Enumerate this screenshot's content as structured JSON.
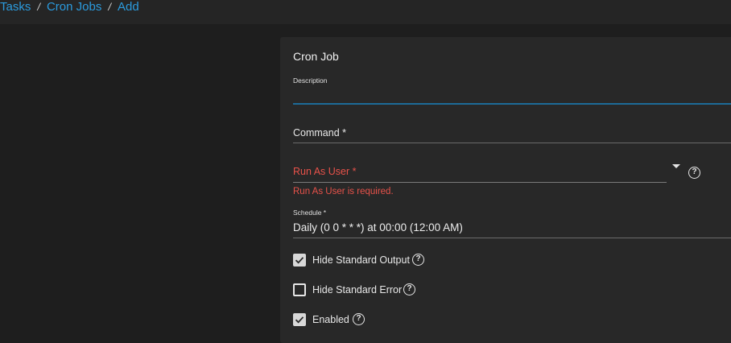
{
  "breadcrumb": {
    "items": [
      "Tasks",
      "Cron Jobs",
      "Add"
    ],
    "separator": "/"
  },
  "form": {
    "title": "Cron Job",
    "description": {
      "label": "Description",
      "value": ""
    },
    "command": {
      "label": "Command *",
      "value": ""
    },
    "run_as_user": {
      "label": "Run As User *",
      "error": "Run As User is required.",
      "value": ""
    },
    "schedule": {
      "label": "Schedule *",
      "value": "Daily (0 0 * * *) at 00:00 (12:00 AM)"
    },
    "hide_stdout": {
      "label": "Hide Standard Output",
      "checked": true
    },
    "hide_stderr": {
      "label": "Hide Standard Error",
      "checked": false
    },
    "enabled": {
      "label": "Enabled",
      "checked": true
    }
  },
  "colors": {
    "accent": "#2b9bde",
    "error": "#e8524a",
    "focus_underline": "#1d6b98"
  },
  "icons": {
    "help": "help-circle-icon",
    "dropdown": "dropdown-arrow-icon",
    "check": "check-icon"
  }
}
